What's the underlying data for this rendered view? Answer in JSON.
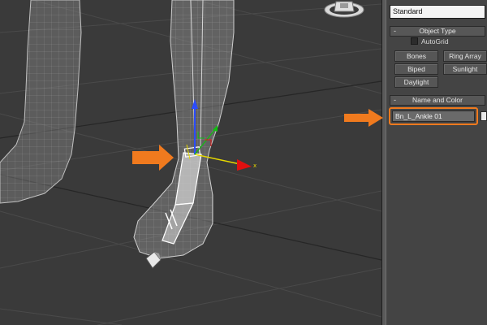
{
  "command_panel": {
    "category_dropdown": "Standard",
    "object_type": {
      "header": "Object Type",
      "collapse_symbol": "-",
      "autogrid_label": "AutoGrid",
      "buttons": [
        "Bones",
        "Ring Array",
        "Biped",
        "Sunlight",
        "Daylight"
      ]
    },
    "name_and_color": {
      "header": "Name and Color",
      "collapse_symbol": "-",
      "name_value": "Bn_L_Ankle 01"
    }
  },
  "viewport": {
    "gizmo_x_label": "x",
    "icons": [
      "viewcube-icon",
      "transform-gizmo-icon",
      "bone-object-icon"
    ]
  },
  "annotations": {
    "arrow_color": "#f07a1e",
    "highlight_color": "#f07a1e"
  }
}
